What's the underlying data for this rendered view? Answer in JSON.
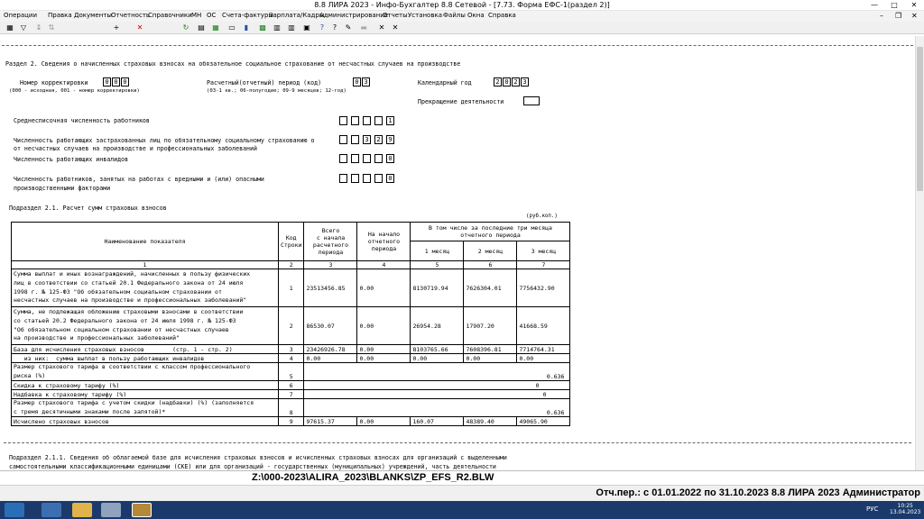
{
  "window": {
    "title": "8.8 ЛИРА 2023 - Инфо-Бухгалтер 8.8 Сетевой - [7.73.    Форма ЕФС-1(раздел 2)]",
    "min_glyph": "—",
    "max_glyph": "□",
    "close_glyph": "✕"
  },
  "menu": {
    "items": [
      "Операции",
      "Правка",
      "Документы",
      "Отчетность",
      "Справочники",
      "МН",
      "ОС",
      "Счета-фактуры",
      "Зарплата/Кадры",
      "Администрирование",
      "Отчеты",
      "Установка",
      "Файлы",
      "Окна",
      "Справка"
    ],
    "right_min": "–",
    "right_restore": "❐",
    "right_close": "✕"
  },
  "toolbar": {
    "glyphs": [
      "▦",
      "▽",
      "↨",
      "⇅",
      "+",
      "✕",
      "↻",
      "▤",
      "▦",
      "▭",
      "▮",
      "▩",
      "▥",
      "▥",
      "⎙",
      "▣",
      "?",
      "?",
      "✎",
      "▬",
      "✕",
      "✕"
    ]
  },
  "section": {
    "heading": "Раздел 2. Сведения о начисленных страховых взносах на обязательное социальное страхование от несчастных случаев на производстве",
    "correction_label": "Номер корректировки",
    "correction_digits": [
      "0",
      "0",
      "0"
    ],
    "correction_hint": "(000 - исходная, 001 - номер  корректировки)",
    "period_label": "Расчетный(отчетный) период (код)",
    "period_digits": [
      "0",
      "3"
    ],
    "period_hint": "(03-1 кв.; 06-полугодие; 09-9 месяцев; 12-год)",
    "year_label": "Календарный год",
    "year_digits": [
      "2",
      "0",
      "2",
      "3"
    ],
    "termination_label": "Прекращение деятельности",
    "avg_headcount_label": "Среднесписочная численность работников",
    "avg_headcount_digits": [
      "",
      "",
      "",
      "",
      "1"
    ],
    "insured_label_1": "Численность работающих застрахованных лиц по обязательному социальному страхованию о",
    "insured_label_2": "от несчастных случаев на производстве и профессиональных заболеваний",
    "insured_digits": [
      "",
      "",
      "3",
      "2",
      "9"
    ],
    "disabled_label": "Численность работающих инвалидов",
    "disabled_digits": [
      "",
      "",
      "",
      "",
      "0"
    ],
    "harmful_label_1": "Численность работников, занятых на работах с вредными и (или) опасными",
    "harmful_label_2": "производственными факторами",
    "harmful_digits": [
      "",
      "",
      "",
      "",
      "0"
    ]
  },
  "subsection": {
    "title": "Подраздел 2.1. Расчет сумм страховых взносов",
    "unit": "(руб.коп.)",
    "headers": {
      "name": "Наименование показателя",
      "code_1": "Код",
      "code_2": "Строки",
      "total_1": "Всего",
      "total_2": "с начала",
      "total_3": "расчетного",
      "total_4": "периода",
      "start_1": "На начало",
      "start_2": "отчетного",
      "start_3": "периода",
      "last3_1": "В том числе за последние три месяца",
      "last3_2": "отчетного периода",
      "m1": "1 месяц",
      "m2": "2 месяц",
      "m3": "3 месяц"
    },
    "colnums": [
      "1",
      "2",
      "3",
      "4",
      "5",
      "6",
      "7"
    ],
    "rows": [
      {
        "name": [
          "Сумма выплат и иных вознаграждений, начисленных в пользу физических",
          "лиц в соответствии со статьей 20.1 Федерального закона от 24 июля",
          "1998 г. № 125-ФЗ \"Об обязательном социальном страховании от",
          "несчастных случаев на производстве и профессиональных заболеваний\""
        ],
        "code": "1",
        "total": "23513456.85",
        "start": "0.00",
        "m1": "8130719.94",
        "m2": "7626304.01",
        "m3": "7756432.90"
      },
      {
        "name": [
          "Сумма, не подлежащая обложению страховыми взносами в соответствии",
          "со статьей 20.2 Федерального закона от 24 июля 1998 г. № 125-ФЗ",
          "\"Об обязательном социальном страховании от несчастных случаев",
          "на производстве и профессиональных заболеваний\""
        ],
        "code": "2",
        "total": "86530.07",
        "start": "0.00",
        "m1": "26954.28",
        "m2": "17907.20",
        "m3": "41668.59"
      },
      {
        "name": [
          "База для исчисления страховых взносов        (стр. 1 - стр. 2)"
        ],
        "code": "3",
        "total": "23426926.78",
        "start": "0.00",
        "m1": "8103765.66",
        "m2": "7608396.81",
        "m3": "7714764.31"
      },
      {
        "name": [
          "   из них:  сумма выплат в пользу работающих инвалидов"
        ],
        "code": "4",
        "total": "0.00",
        "start": "0.00",
        "m1": "0.00",
        "m2": "0.00",
        "m3": "0.00"
      }
    ],
    "single_rows": [
      {
        "name": [
          "Размер страхового тарифа в соответствии с классом профессионального",
          "риска (%)"
        ],
        "code": "5",
        "value": "0.636"
      },
      {
        "name": [
          "Скидка к страховому тарифу (%)"
        ],
        "code": "6",
        "value": "0"
      },
      {
        "name": [
          "Надбавка к страховому тарифу (%)"
        ],
        "code": "7",
        "value": "0"
      },
      {
        "name": [
          "Размер страхового тарифа с учетом скидки (надбавки) (%) (заполняется",
          "с тремя десятичными знаками после запятой)*"
        ],
        "code": "8",
        "value": "0.636"
      }
    ],
    "last_row": {
      "name": "Исчислено страховых взносов",
      "code": "9",
      "total": "97615.37",
      "start": "0.00",
      "m1": "160.07",
      "m2": "48389.40",
      "m3": "49065.90"
    }
  },
  "subsection2": {
    "title_1": "Подраздел 2.1.1. Сведения об облагаемой базе для исчисления страховых взносов и исчисленных страховых взносах для организаций с выделенными",
    "title_2": "самостоятельными классификационными единицами (СКЕ) или для организаций - государственных (муниципальных) учреждений, часть деятельности"
  },
  "path": "Z:\\000-2023\\ALIRA_2023\\BLANKS\\ZP_EFS_R2.BLW",
  "status": "Отч.пер.: с 01.01.2022 по 31.10.2023 8.8 ЛИРА 2023 Администратор",
  "tray": {
    "lang": "РУС",
    "time": "10:25",
    "date": "13.04.2023"
  },
  "colors": {
    "taskbar": "#1b3a6b",
    "accent": "#2a6fb5"
  }
}
